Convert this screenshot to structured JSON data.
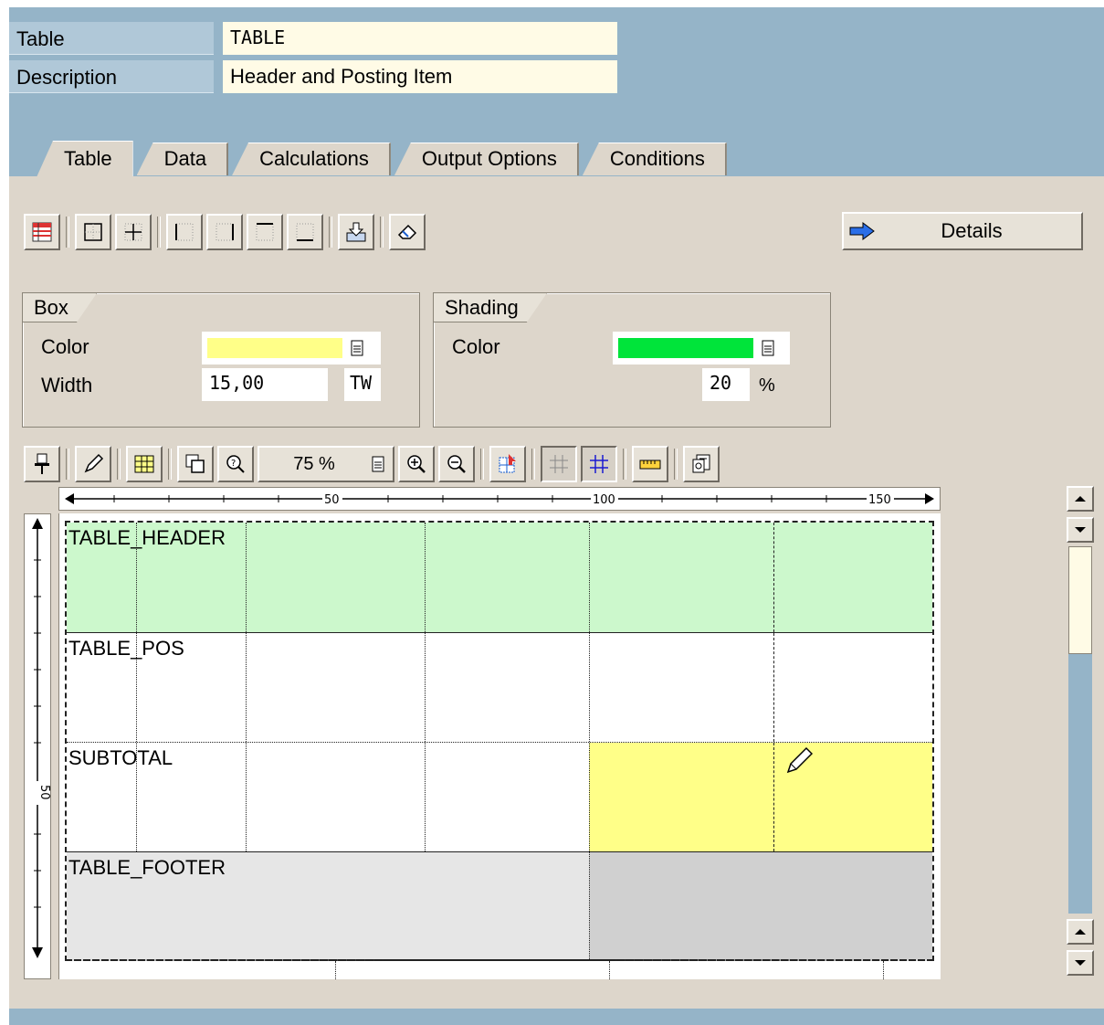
{
  "header": {
    "table_label": "Table",
    "table_value": "TABLE",
    "description_label": "Description",
    "description_value": "Header and Posting Item"
  },
  "tabs": [
    {
      "label": "Table",
      "active": true
    },
    {
      "label": "Data",
      "active": false
    },
    {
      "label": "Calculations",
      "active": false
    },
    {
      "label": "Output Options",
      "active": false
    },
    {
      "label": "Conditions",
      "active": false
    }
  ],
  "toolbar": {
    "details_label": "Details"
  },
  "box_group": {
    "title": "Box",
    "color_label": "Color",
    "color_value": "#ffff88",
    "width_label": "Width",
    "width_value": "15,00",
    "width_unit": "TW"
  },
  "shading_group": {
    "title": "Shading",
    "color_label": "Color",
    "color_value": "#00e43a",
    "percent_value": "20",
    "percent_unit": "%"
  },
  "zoom": {
    "value": "75 %"
  },
  "ruler": {
    "h_ticks": [
      "50",
      "100",
      "150"
    ],
    "v_ticks": [
      "50"
    ]
  },
  "table_lines": [
    {
      "name": "TABLE_HEADER",
      "fill": "#ccf8cc"
    },
    {
      "name": "TABLE_POS",
      "fill": "#ffffff"
    },
    {
      "name": "SUBTOTAL",
      "fill": "#ffffff",
      "highlight": "#ffff88"
    },
    {
      "name": "TABLE_FOOTER",
      "fill": "#e6e6e6",
      "highlight": "#d0d0d0"
    }
  ],
  "colors": {
    "window_blue": "#95b4c8",
    "panel_beige": "#ddd6cb",
    "input_bg": "#fffbe6"
  }
}
